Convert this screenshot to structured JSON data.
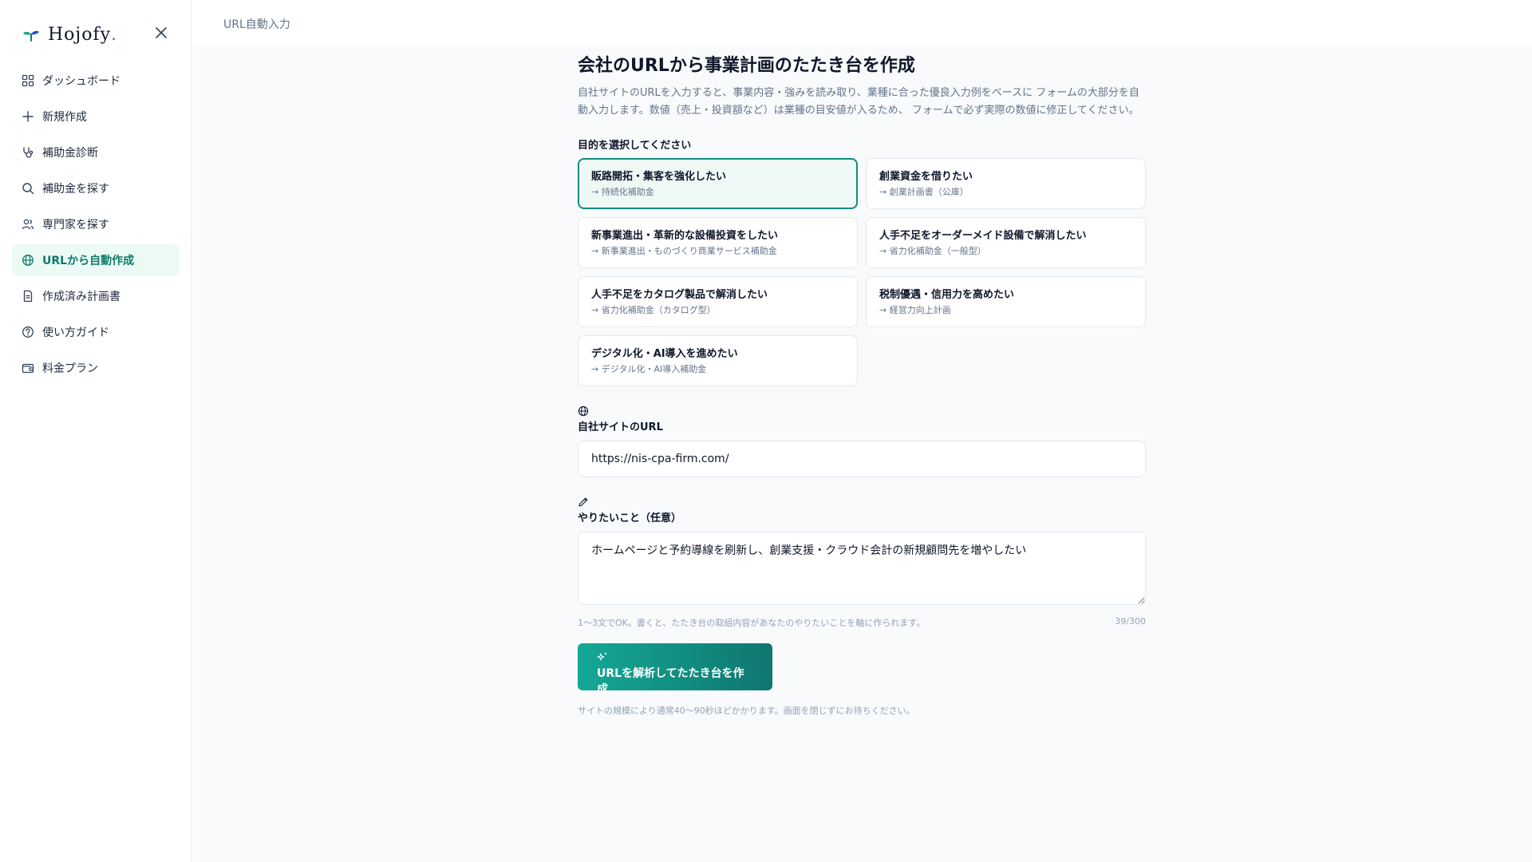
{
  "brand": {
    "name": "Hojofy",
    "dot": "."
  },
  "sidebar": {
    "items": [
      {
        "label": "ダッシュボード",
        "icon": "grid-icon"
      },
      {
        "label": "新規作成",
        "icon": "plus-icon"
      },
      {
        "label": "補助金診断",
        "icon": "stethoscope-icon"
      },
      {
        "label": "補助金を探す",
        "icon": "search-icon"
      },
      {
        "label": "専門家を探す",
        "icon": "users-icon"
      },
      {
        "label": "URLから自動作成",
        "icon": "globe-icon",
        "active": true
      },
      {
        "label": "作成済み計画書",
        "icon": "document-icon"
      },
      {
        "label": "使い方ガイド",
        "icon": "help-circle-icon"
      },
      {
        "label": "料金プラン",
        "icon": "wallet-icon"
      }
    ]
  },
  "header": {
    "breadcrumb": "URL自動入力"
  },
  "main": {
    "title": "会社のURLから事業計画のたたき台を作成",
    "description": "自社サイトのURLを入力すると、事業内容・強みを読み取り、業種に合った優良入力例をベースに フォームの大部分を自動入力します。数値（売上・投資額など）は業種の目安値が入るため、 フォームで必ず実際の数値に修正してください。",
    "purpose_label": "目的を選択してください",
    "purposes": [
      {
        "title": "販路開拓・集客を強化したい",
        "sub": "→ 持続化補助金",
        "selected": true
      },
      {
        "title": "創業資金を借りたい",
        "sub": "→ 創業計画書（公庫）"
      },
      {
        "title": "新事業進出・革新的な設備投資をしたい",
        "sub": "→ 新事業進出・ものづくり商業サービス補助金"
      },
      {
        "title": "人手不足をオーダーメイド設備で解消したい",
        "sub": "→ 省力化補助金（一般型）"
      },
      {
        "title": "人手不足をカタログ製品で解消したい",
        "sub": "→ 省力化補助金（カタログ型）"
      },
      {
        "title": "税制優遇・信用力を高めたい",
        "sub": "→ 経営力向上計画"
      },
      {
        "title": "デジタル化・AI導入を進めたい",
        "sub": "→ デジタル化・AI導入補助金"
      }
    ],
    "url_field": {
      "label": "自社サイトのURL",
      "value": "https://nis-cpa-firm.com/",
      "icon": "globe-icon"
    },
    "goal_field": {
      "label": "やりたいこと（任意）",
      "value": "ホームページと予約導線を刷新し、創業支援・クラウド会計の新規顧問先を増やしたい",
      "icon": "pencil-icon",
      "hint": "1〜3文でOK。書くと、たたき台の取組内容があなたのやりたいことを軸に作られます。",
      "counter": "39/300"
    },
    "submit": {
      "label": "URLを解析してたたき台を作成",
      "icon": "sparkles-icon"
    },
    "note": "サイトの規模により通常40〜90秒ほどかかります。画面を閉じずにお待ちください。"
  },
  "colors": {
    "accent": "#0f8f7c",
    "accent_bg": "#ecfaf6",
    "button_start": "#14a896",
    "button_end": "#0f766e"
  }
}
